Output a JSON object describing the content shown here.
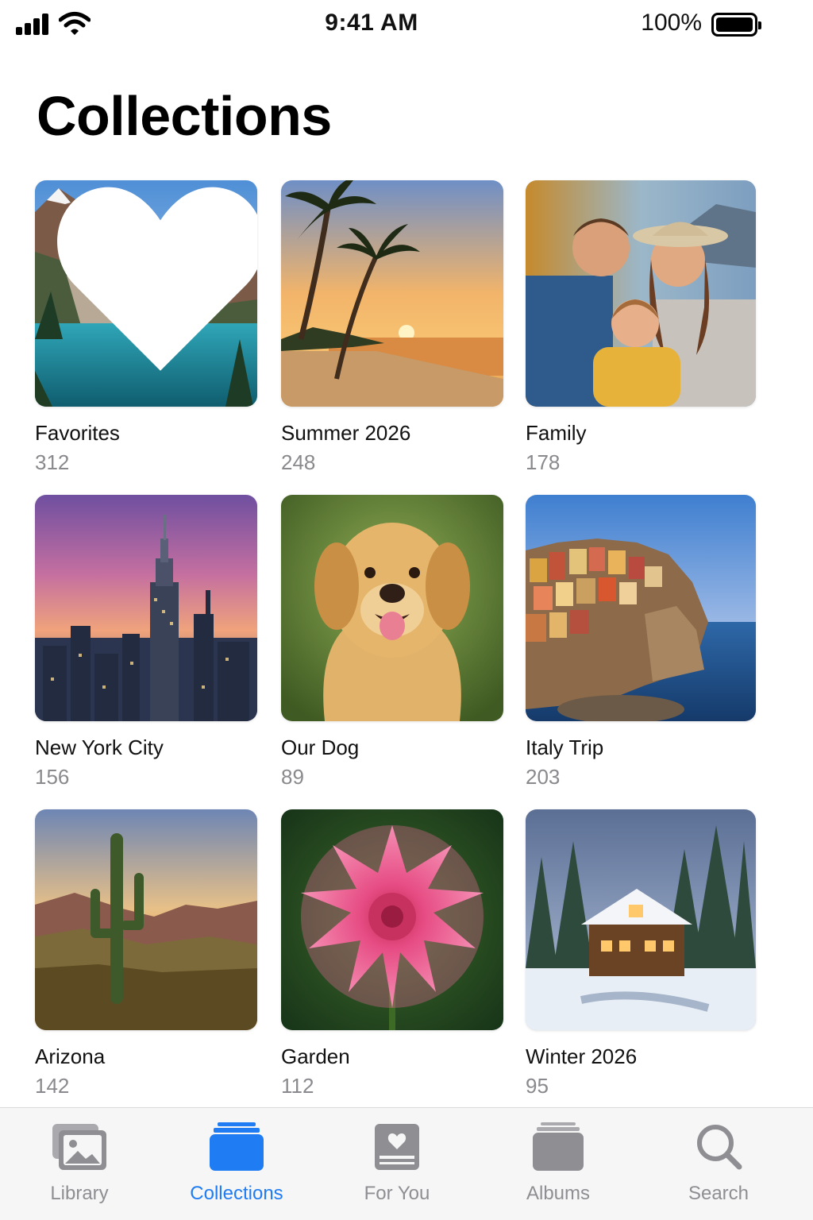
{
  "status_bar": {
    "time": "9:41 AM",
    "battery_percent": "100%",
    "icons": [
      "cellular-signal-icon",
      "wifi-icon",
      "battery-icon"
    ]
  },
  "page": {
    "title": "Collections"
  },
  "collections": [
    {
      "name": "Favorites",
      "count": "312",
      "image": "mountain-lake",
      "badge": "heart-icon"
    },
    {
      "name": "Summer 2026",
      "count": "248",
      "image": "palm-beach-sunset"
    },
    {
      "name": "Family",
      "count": "178",
      "image": "family-portrait"
    },
    {
      "name": "New York City",
      "count": "156",
      "image": "city-skyline-dusk"
    },
    {
      "name": "Our Dog",
      "count": "89",
      "image": "golden-retriever"
    },
    {
      "name": "Italy Trip",
      "count": "203",
      "image": "coastal-village"
    },
    {
      "name": "Arizona",
      "count": "142",
      "image": "desert-cactus-sunset"
    },
    {
      "name": "Garden",
      "count": "112",
      "image": "pink-dahlia"
    },
    {
      "name": "Winter 2026",
      "count": "95",
      "image": "snowy-cabin"
    }
  ],
  "tab_bar": {
    "active": "Collections",
    "tabs": [
      {
        "label": "Library",
        "icon": "photo-icon"
      },
      {
        "label": "Collections",
        "icon": "stack-icon"
      },
      {
        "label": "For You",
        "icon": "heart-card-icon"
      },
      {
        "label": "Albums",
        "icon": "album-stack-icon"
      },
      {
        "label": "Search",
        "icon": "search-icon"
      }
    ]
  },
  "colors": {
    "accent": "#1f7cf2",
    "inactive_tab": "#8e8e93",
    "secondary_text": "#8a8a8e",
    "tab_bar_bg": "#f6f6f7"
  }
}
